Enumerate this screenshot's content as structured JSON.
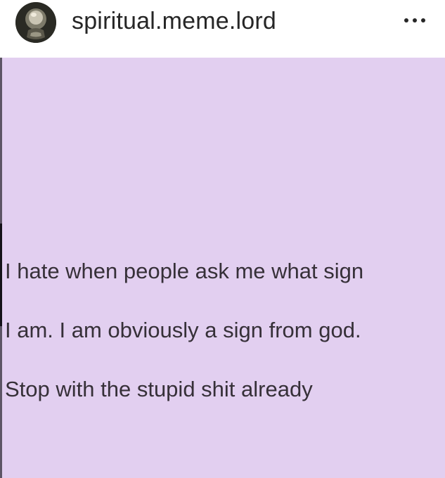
{
  "post": {
    "username": "spiritual.meme.lord",
    "more_icon": "more-horizontal-icon",
    "avatar_icon": "crystal-ball-avatar"
  },
  "image": {
    "background_color": "#e2cff0",
    "text_color": "#363038",
    "lines": [
      "I hate when people ask me what sign",
      "I am. I am obviously a sign from god.",
      "Stop with the stupid shit already"
    ]
  }
}
